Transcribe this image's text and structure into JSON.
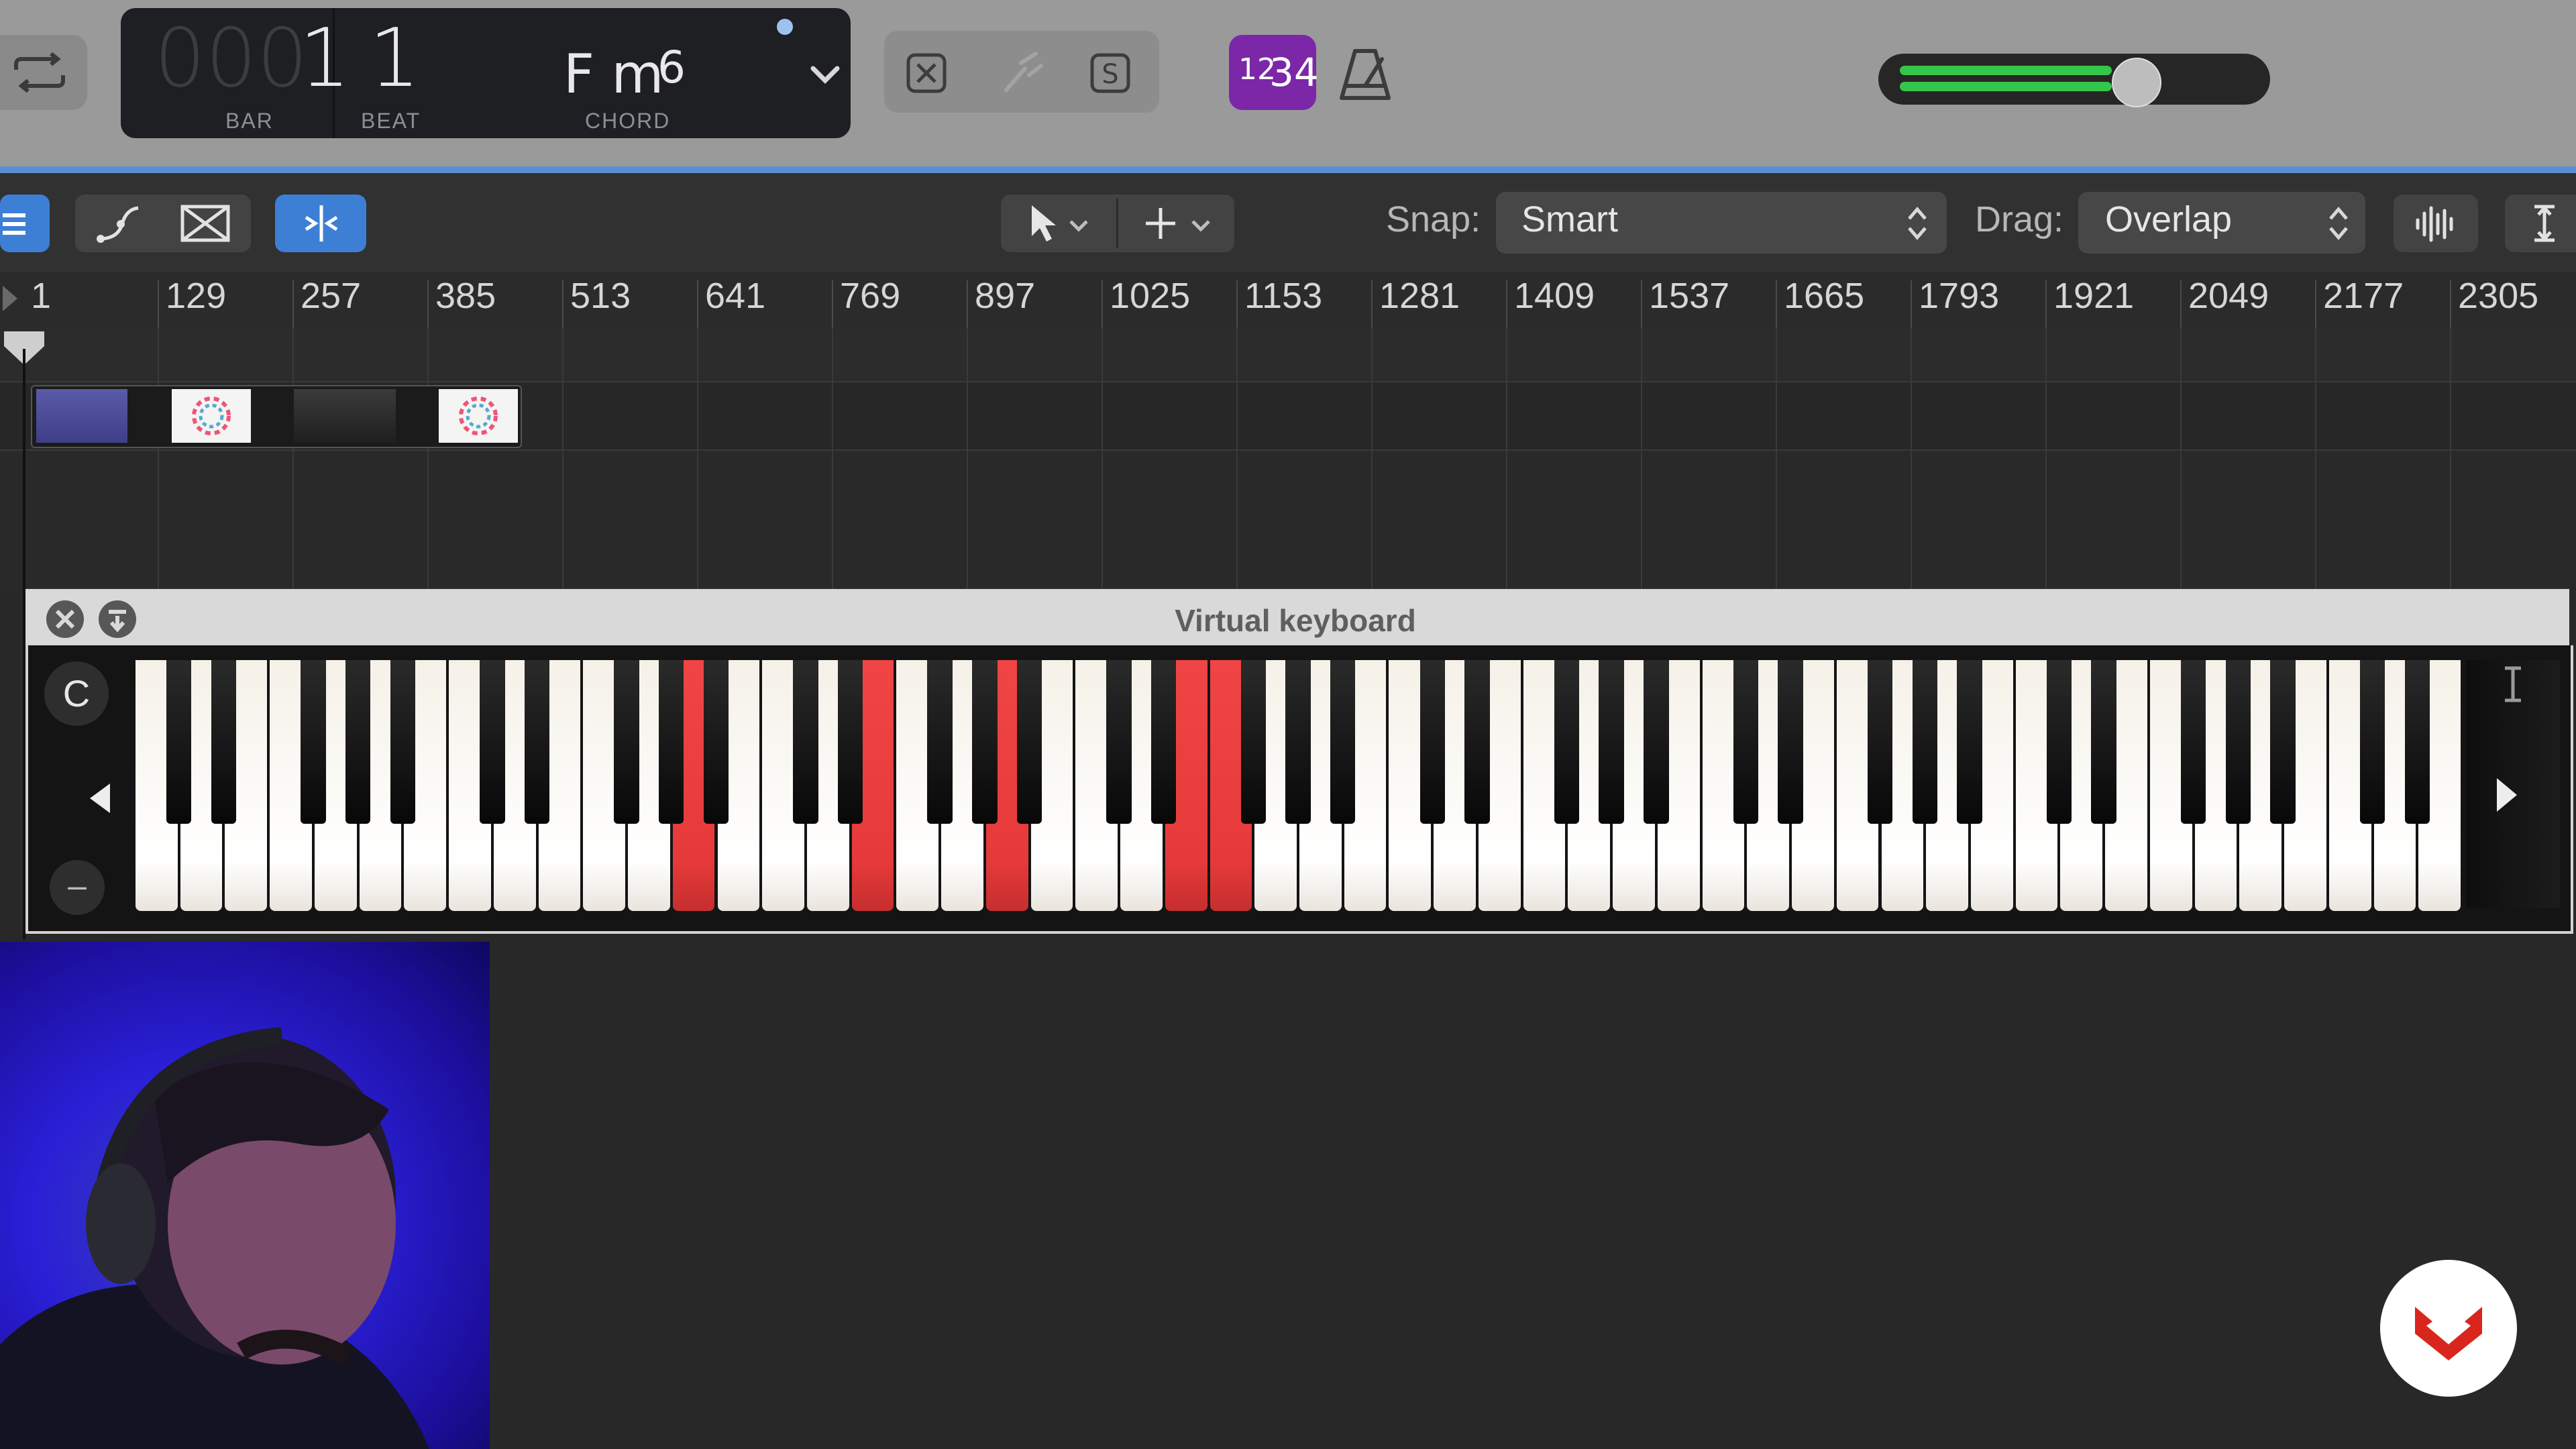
{
  "lcd": {
    "bar_dim": "000",
    "bar": "1",
    "beat": "1",
    "bar_label": "BAR",
    "beat_label": "BEAT",
    "chord_root": "F m",
    "chord_ext": "6",
    "chord_label": "CHORD"
  },
  "transport": {
    "count_in_small": "12",
    "count_in_large": "34"
  },
  "volume": {
    "level": 0.62
  },
  "toolbar": {
    "snap_label": "Snap:",
    "snap_value": "Smart",
    "drag_label": "Drag:",
    "drag_value": "Overlap"
  },
  "ruler": {
    "labels": [
      "1",
      "129",
      "257",
      "385",
      "513",
      "641",
      "769",
      "897",
      "1025",
      "1153",
      "1281",
      "1409",
      "1537",
      "1665",
      "1793",
      "1921",
      "2049",
      "2177",
      "2305"
    ]
  },
  "virtual_keyboard": {
    "title": "Virtual keyboard",
    "octave_label": "C",
    "minus_label": "–",
    "white_key_count": 52,
    "pressed_white_keys": [
      12,
      16,
      19,
      23,
      24
    ],
    "pressed_black_keys": [
      16
    ]
  },
  "colors": {
    "accent_blue": "#3d7fd4",
    "key_pressed": "#e63a3a",
    "count_in_purple": "#7b27a8",
    "volume_green": "#33c64a"
  }
}
